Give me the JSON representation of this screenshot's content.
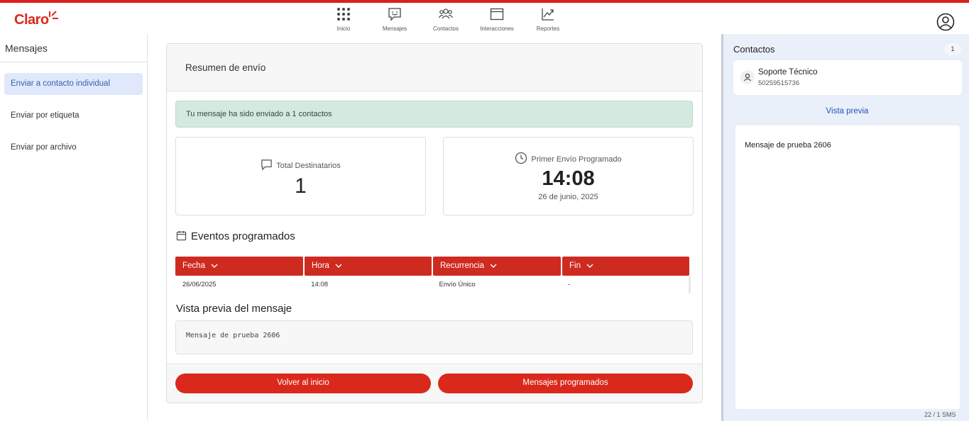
{
  "app": {
    "brand": "Claro",
    "accent_color": "#da291c"
  },
  "nav": {
    "items": [
      {
        "label": "Inicio",
        "icon": "grid-icon"
      },
      {
        "label": "Mensajes",
        "icon": "message-smile-icon"
      },
      {
        "label": "Contactos",
        "icon": "users-icon"
      },
      {
        "label": "Interacciones",
        "icon": "window-icon"
      },
      {
        "label": "Reportes",
        "icon": "trend-icon"
      }
    ]
  },
  "sidebar": {
    "title": "Mensajes",
    "items": [
      {
        "label": "Enviar a contacto individual",
        "active": true
      },
      {
        "label": "Enviar por etiqueta",
        "active": false
      },
      {
        "label": "Enviar por archivo",
        "active": false
      }
    ]
  },
  "summary": {
    "title": "Resumen de envío",
    "alert": "Tu mensaje ha sido enviado a 1 contactos",
    "total_label": "Total Destinatarios",
    "total_value": "1",
    "first_label": "Primer Envío Programado",
    "first_time": "14:08",
    "first_date": "26 de junio, 2025",
    "events_title": "Eventos programados",
    "columns": [
      "Fecha",
      "Hora",
      "Recurrencia",
      "Fin"
    ],
    "rows": [
      [
        "26/06/2025",
        "14:08",
        "Envío Único",
        "-"
      ]
    ],
    "preview_title": "Vista previa del mensaje",
    "preview_text": "Mensaje de prueba 2606",
    "btn_home": "Volver al inicio",
    "btn_scheduled": "Mensajes programados"
  },
  "right": {
    "title": "Contactos",
    "count": "1",
    "contact_name": "Soporte Técnico",
    "contact_phone": "50259515736",
    "preview_link": "Vista previa",
    "message": "Mensaje de prueba 2606",
    "sms_count": "22 / 1 SMS"
  }
}
